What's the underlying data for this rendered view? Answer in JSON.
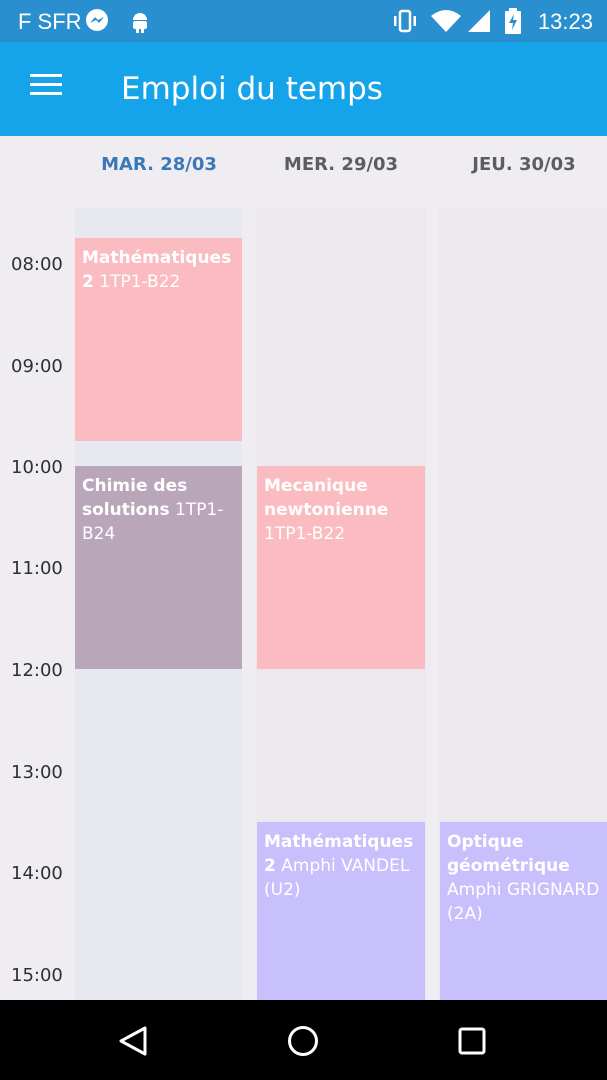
{
  "status_bar": {
    "carrier": "F SFR",
    "time": "13:23",
    "icons": [
      "messenger-icon",
      "android-icon",
      "vibrate-icon",
      "wifi-icon",
      "signal-icon",
      "battery-charging-icon"
    ]
  },
  "app_bar": {
    "title": "Emploi du temps",
    "menu_icon": "hamburger-menu-icon"
  },
  "days": [
    {
      "label": "MAR. 28/03",
      "active": true
    },
    {
      "label": "MER. 29/03",
      "active": false
    },
    {
      "label": "JEU. 30/03",
      "active": false
    }
  ],
  "hours": [
    "08:00",
    "09:00",
    "10:00",
    "11:00",
    "12:00",
    "13:00",
    "14:00",
    "15:00"
  ],
  "events": [
    {
      "title": "Mathématiques 2",
      "room": "1TP1-B22",
      "day": 0,
      "start": "08:00",
      "end": "10:00",
      "color": "#fbbcc1"
    },
    {
      "title": "Chimie des solutions",
      "room": "1TP1-B24",
      "day": 0,
      "start": "10:00",
      "end": "12:00",
      "color": "#b9a6b9"
    },
    {
      "title": "Mecanique newtonienne",
      "room": "1TP1-B22",
      "day": 1,
      "start": "10:00",
      "end": "12:00",
      "color": "#fbbcc1"
    },
    {
      "title": "Mathématiques 2",
      "room": "Amphi VANDEL (U2)",
      "day": 1,
      "start": "13:30",
      "end": "15:30",
      "color": "#c8c0fc"
    },
    {
      "title": "Optique géométrique",
      "room": "Amphi GRIGNARD (2A)",
      "day": 2,
      "start": "13:30",
      "end": "15:30",
      "color": "#c8c0fc"
    }
  ],
  "colors": {
    "status_bar": "#2a8fcf",
    "app_bar": "#15a4ea",
    "active_day": "#3a78b8",
    "background": "#efedf1"
  },
  "nav_bar": {
    "icons": [
      "back-icon",
      "home-icon",
      "recents-icon"
    ]
  }
}
